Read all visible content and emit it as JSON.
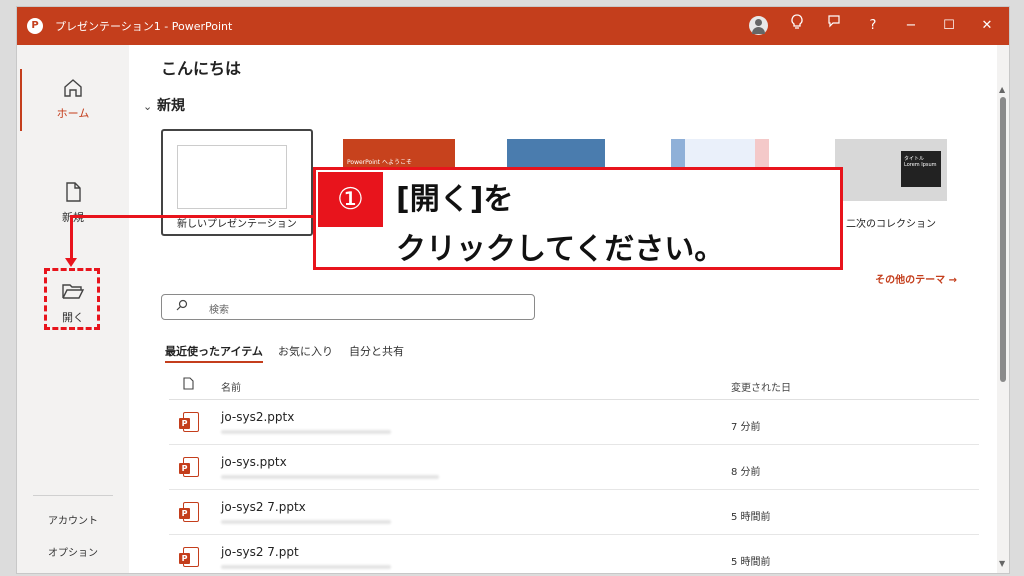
{
  "window": {
    "title": "プレゼンテーション1  -  PowerPoint",
    "controls": {
      "help": "?",
      "minimize": "−",
      "maximize": "☐",
      "close": "✕"
    },
    "accent": "#c43e1c"
  },
  "sidebar": {
    "home": "ホーム",
    "new": "新規",
    "open": "開く",
    "account": "アカウント",
    "options": "オプション"
  },
  "main": {
    "greeting": "こんにちは",
    "new_section": "新規",
    "templates": [
      {
        "label": "新しいプレゼンテーション"
      },
      {
        "label": "PowerPoint へようこそ",
        "thumb_text": "PowerPoint へようこそ"
      },
      {
        "label": "",
        "thumb_text": ""
      },
      {
        "label": "",
        "thumb_text": ""
      },
      {
        "label": "二次のコレクション",
        "thumb_text": "タイトル Lorem Ipsum"
      }
    ],
    "more_themes": "その他のテーマ →",
    "search_placeholder": "検索",
    "tabs": [
      "最近使ったアイテム",
      "お気に入り",
      "自分と共有"
    ],
    "list_headers": {
      "name": "名前",
      "modified": "変更された日"
    },
    "files": [
      {
        "name": "jo-sys2.pptx",
        "modified": "7 分前",
        "badge": "P"
      },
      {
        "name": "jo-sys.pptx",
        "modified": "8 分前",
        "badge": "P"
      },
      {
        "name": "jo-sys2 7.pptx",
        "modified": "5 時間前",
        "badge": "P"
      },
      {
        "name": "jo-sys2 7.ppt",
        "modified": "5 時間前",
        "badge": "P"
      }
    ]
  },
  "annotation": {
    "number": "①",
    "line1": "[開く]を",
    "line2": "クリックしてください。",
    "color": "#e8141c"
  }
}
